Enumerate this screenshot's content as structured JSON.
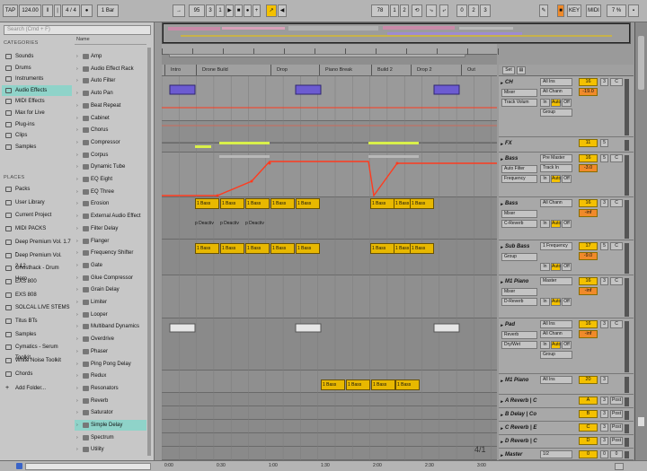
{
  "transport": {
    "tap": "TAP",
    "bpm": "124.00",
    "sig": "4 / 4",
    "metro": "1 Bar",
    "pos": "95",
    "pos2": "3",
    "pos3": "1",
    "loop1": "78",
    "loop2": "1",
    "loop3": "2",
    "loop4": "0",
    "loop5": "2",
    "loop6": "3",
    "key": "KEY",
    "midi": "MIDI",
    "cpu": "7 %"
  },
  "browser": {
    "search_placeholder": "Search (Cmd + F)",
    "categories_header": "CATEGORIES",
    "categories": [
      "Sounds",
      "Drums",
      "Instruments",
      "Audio Effects",
      "MIDI Effects",
      "Max for Live",
      "Plug-ins",
      "Clips",
      "Samples"
    ],
    "places_header": "PLACES",
    "places": [
      "Packs",
      "User Library",
      "Current Project",
      "MIDI PACKS",
      "Deep Premium Vol. 1.7 -",
      "Deep Premium Vol. 2.12",
      "Ghosthack - Drum Hero",
      "EXS 800",
      "EXS 808",
      "SOLCAL LIVE STEMS",
      "Titus BTs",
      "Samples",
      "Cymatics - Serum Toolkit",
      "White Noise Toolkit",
      "Chords"
    ],
    "add_folder": "Add Folder...",
    "name_header": "Name",
    "items": [
      "Amp",
      "Audio Effect Rack",
      "Auto Filter",
      "Auto Pan",
      "Beat Repeat",
      "Cabinet",
      "Chorus",
      "Compressor",
      "Corpus",
      "Dynamic Tube",
      "EQ Eight",
      "EQ Three",
      "Erosion",
      "External Audio Effect",
      "Filter Delay",
      "Flanger",
      "Frequency Shifter",
      "Gate",
      "Glue Compressor",
      "Grain Delay",
      "Limiter",
      "Looper",
      "Multiband Dynamics",
      "Overdrive",
      "Phaser",
      "Ping Pong Delay",
      "Redux",
      "Resonators",
      "Reverb",
      "Saturator",
      "Simple Delay",
      "Spectrum",
      "Utility"
    ]
  },
  "arrangement": {
    "locators": [
      "Intro",
      "Drone Build",
      "Drop",
      "Piano Break",
      "Build 2",
      "Drop 2",
      "Out"
    ],
    "time_labels": [
      "0:00",
      "0:30",
      "1:00",
      "1:30",
      "2:00",
      "2:30",
      "3:00"
    ],
    "bar_count": "4/1",
    "clip_labels": {
      "bass": "1 Bass",
      "deact": "p Deactiv"
    }
  },
  "mixer": {
    "set_label": "Set",
    "tracks": [
      {
        "name": "CH",
        "in": "All Ins",
        "chan": "All Chann",
        "mon": "Mixer",
        "sub": "Track Volum",
        "grp": "Group",
        "vol": "16",
        "pan": "-19.0",
        "n": "3",
        "c": "C"
      },
      {
        "name": "FX",
        "vol": "11",
        "n": "5"
      },
      {
        "name": "Bass",
        "in": "Pre Master",
        "chan": "Track In",
        "mon": "Auto Filter",
        "sub": "Frequency",
        "vol": "16",
        "pan": "-3.0",
        "n": "5",
        "c": "C"
      },
      {
        "name": "Bass",
        "in": "All Chann",
        "mon": "Mixer",
        "sub": "C-Reverb",
        "vol": "16",
        "pan": "-inf",
        "n": "3",
        "c": "C"
      },
      {
        "name": "Sub Bass",
        "in": "1 Frequency",
        "mon": "Group",
        "vol": "17",
        "pan": "-9.0",
        "n": "5",
        "c": "C"
      },
      {
        "name": "M1 Piano",
        "in": "Master",
        "mon": "Mixer",
        "sub": "D-Reverb",
        "vol": "16",
        "pan": "-inf",
        "n": "3",
        "c": "C"
      },
      {
        "name": "Pad",
        "in": "All Ins",
        "chan": "All Chann",
        "mon": "Reverb",
        "sub": "Dry/Wet",
        "grp": "Group",
        "vol": "16",
        "pan": "-inf",
        "n": "3",
        "c": "C"
      },
      {
        "name": "M1 Piano",
        "in": "All Ins",
        "vol": "20",
        "n": "3"
      },
      {
        "name": "A Reverb | C",
        "vol": "A",
        "n": "3",
        "c": "Post"
      },
      {
        "name": "B Delay | Co",
        "vol": "B",
        "n": "3",
        "c": "Post"
      },
      {
        "name": "C Reverb | E",
        "vol": "C",
        "n": "3",
        "c": "Post"
      },
      {
        "name": "D Reverb | C",
        "vol": "D",
        "n": "3",
        "c": "Post"
      },
      {
        "name": "Master",
        "in": "1/2",
        "vol": "0",
        "n": "0",
        "c": "0"
      }
    ],
    "io": {
      "in": "In",
      "auto": "Auto",
      "off": "Off"
    }
  },
  "colors": {
    "accent": "#f4c100",
    "selection": "#8fd3c9",
    "clip": "#e8b800",
    "automation": "#ff3b1f",
    "midi_clip": "#6c5bd1"
  }
}
